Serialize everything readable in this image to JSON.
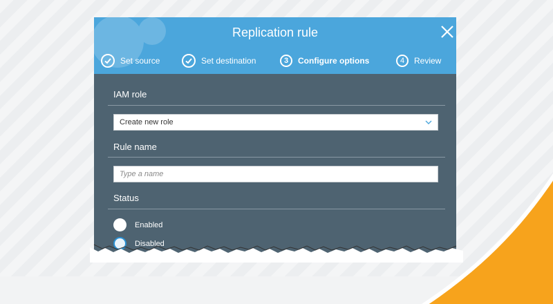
{
  "modal": {
    "title": "Replication rule",
    "steps": [
      {
        "label": "Set source",
        "state": "done",
        "marker": "check-icon"
      },
      {
        "label": "Set destination",
        "state": "done",
        "marker": "check-icon"
      },
      {
        "label": "Configure options",
        "state": "active",
        "number": "3"
      },
      {
        "label": "Review",
        "state": "upcoming",
        "number": "4"
      }
    ]
  },
  "form": {
    "iam_role": {
      "label": "IAM role",
      "selected": "Create new role"
    },
    "rule_name": {
      "label": "Rule name",
      "value": "",
      "placeholder": "Type a name"
    },
    "status": {
      "label": "Status",
      "options": [
        {
          "label": "Enabled",
          "selected": false
        },
        {
          "label": "Disabled",
          "selected": true
        }
      ]
    }
  },
  "colors": {
    "header": "#4ba6dc",
    "body": "#4e6371",
    "radio_selected": "#2a8fd1",
    "accent_orange": "#f7a31c"
  }
}
